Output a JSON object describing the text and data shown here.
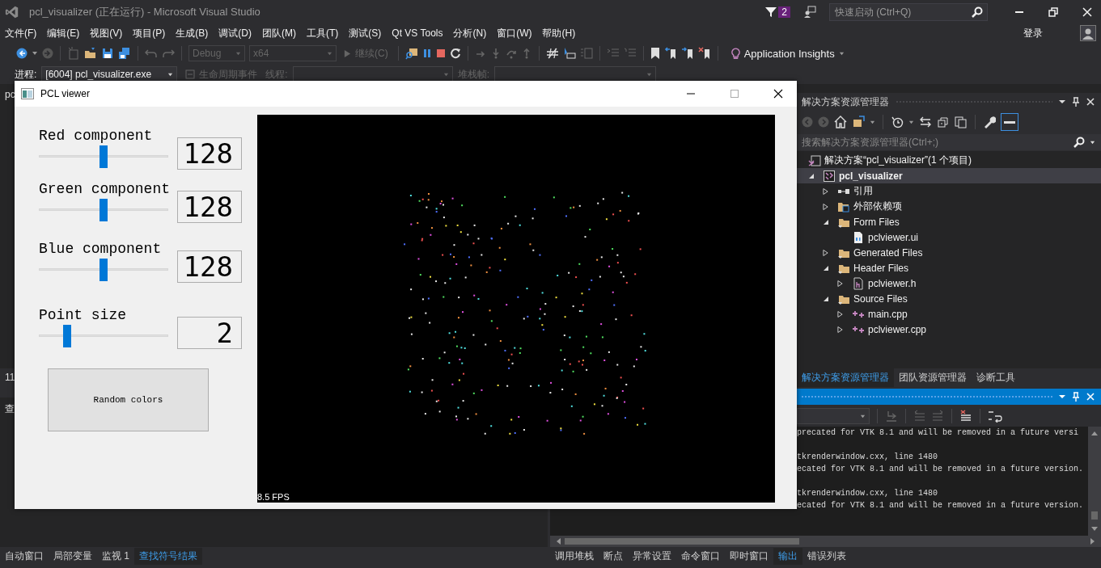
{
  "window": {
    "title": "pcl_visualizer (正在运行) - Microsoft Visual Studio"
  },
  "notifications": {
    "count": "2"
  },
  "quick_launch": {
    "placeholder": "快速启动 (Ctrl+Q)"
  },
  "menu": [
    "文件(F)",
    "编辑(E)",
    "视图(V)",
    "项目(P)",
    "生成(B)",
    "调试(D)",
    "团队(M)",
    "工具(T)",
    "测试(S)",
    "Qt VS Tools",
    "分析(N)",
    "窗口(W)",
    "帮助(H)"
  ],
  "sign_in": "登录",
  "toolbar": {
    "configuration": {
      "value": "Debug",
      "disabled": true
    },
    "platform": {
      "value": "x64",
      "disabled": true
    },
    "continue": {
      "label": "继续(C)",
      "disabled": true
    },
    "insights": "Application Insights"
  },
  "debug_location": {
    "process_label": "进程:",
    "process": "[6004] pcl_visualizer.exe",
    "lifecycle": {
      "label": "生命周期事件",
      "disabled": true
    },
    "thread_label": "线程:",
    "stack_label": "堆栈帧:"
  },
  "background_panels": {
    "top_title": "pc",
    "middle_text": "11",
    "bottom_title": "查"
  },
  "pcl_viewer": {
    "title": "PCL viewer",
    "sliders": [
      {
        "label": "Red component",
        "level": 0.5,
        "value": "128"
      },
      {
        "label": "Green component",
        "level": 0.5,
        "value": "128"
      },
      {
        "label": "Blue component",
        "level": 0.5,
        "value": "128"
      },
      {
        "label": "Point size",
        "level": 0.2,
        "value": "2"
      }
    ],
    "button": "Random colors",
    "fps": "8.5 FPS"
  },
  "solution_explorer": {
    "title": "解决方案资源管理器",
    "search": {
      "placeholder": "搜索解决方案资源管理器(Ctrl+;)"
    },
    "tree": [
      {
        "kind": "solution",
        "label": "解决方案“pcl_visualizer”(1 个项目)",
        "selected": false,
        "children": [
          {
            "kind": "project",
            "label": "pcl_visualizer",
            "expanded": true,
            "selected": true,
            "children": [
              {
                "kind": "references",
                "label": "引用",
                "expanded": false,
                "selected": false
              },
              {
                "kind": "external",
                "label": "外部依赖项",
                "expanded": false,
                "selected": false
              },
              {
                "kind": "filter",
                "label": "Form Files",
                "expanded": true,
                "selected": false,
                "children": [
                  {
                    "kind": "ui",
                    "label": "pclviewer.ui",
                    "selected": false
                  }
                ]
              },
              {
                "kind": "filter",
                "label": "Generated Files",
                "expanded": false,
                "selected": false
              },
              {
                "kind": "filter",
                "label": "Header Files",
                "expanded": true,
                "selected": false,
                "children": [
                  {
                    "kind": "header",
                    "label": "pclviewer.h",
                    "expanded": false,
                    "selected": false
                  }
                ]
              },
              {
                "kind": "filter",
                "label": "Source Files",
                "expanded": true,
                "selected": false,
                "children": [
                  {
                    "kind": "cpp",
                    "label": "main.cpp",
                    "expanded": false,
                    "selected": false
                  },
                  {
                    "kind": "cpp",
                    "label": "pclviewer.cpp",
                    "expanded": false,
                    "selected": false
                  }
                ]
              }
            ]
          }
        ]
      }
    ],
    "tabs": [
      {
        "label": "解决方案资源管理器",
        "selected": true
      },
      {
        "label": "团队资源管理器",
        "selected": false
      },
      {
        "label": "诊断工具",
        "selected": false
      }
    ]
  },
  "output": {
    "messages": [
      {
        "lines": [
          "precated for VTK 8.1 and will be removed in a future versi"
        ]
      },
      {
        "lines": [
          "tkrenderwindow.cxx, line 1480",
          "ecated for VTK 8.1 and will be removed in a future version."
        ]
      },
      {
        "lines": [
          "tkrenderwindow.cxx, line 1480",
          "ecated for VTK 8.1 and will be removed in a future version."
        ]
      }
    ]
  },
  "bottom_tabs_left": [
    {
      "label": "自动窗口",
      "selected": false
    },
    {
      "label": "局部变量",
      "selected": false
    },
    {
      "label": "监视 1",
      "selected": false
    },
    {
      "label": "查找符号结果",
      "selected": true
    }
  ],
  "bottom_tabs_right": [
    {
      "label": "调用堆栈",
      "selected": false
    },
    {
      "label": "断点",
      "selected": false
    },
    {
      "label": "异常设置",
      "selected": false
    },
    {
      "label": "命令窗口",
      "selected": false
    },
    {
      "label": "即时窗口",
      "selected": false
    },
    {
      "label": "输出",
      "selected": true
    },
    {
      "label": "错误列表",
      "selected": false
    }
  ]
}
